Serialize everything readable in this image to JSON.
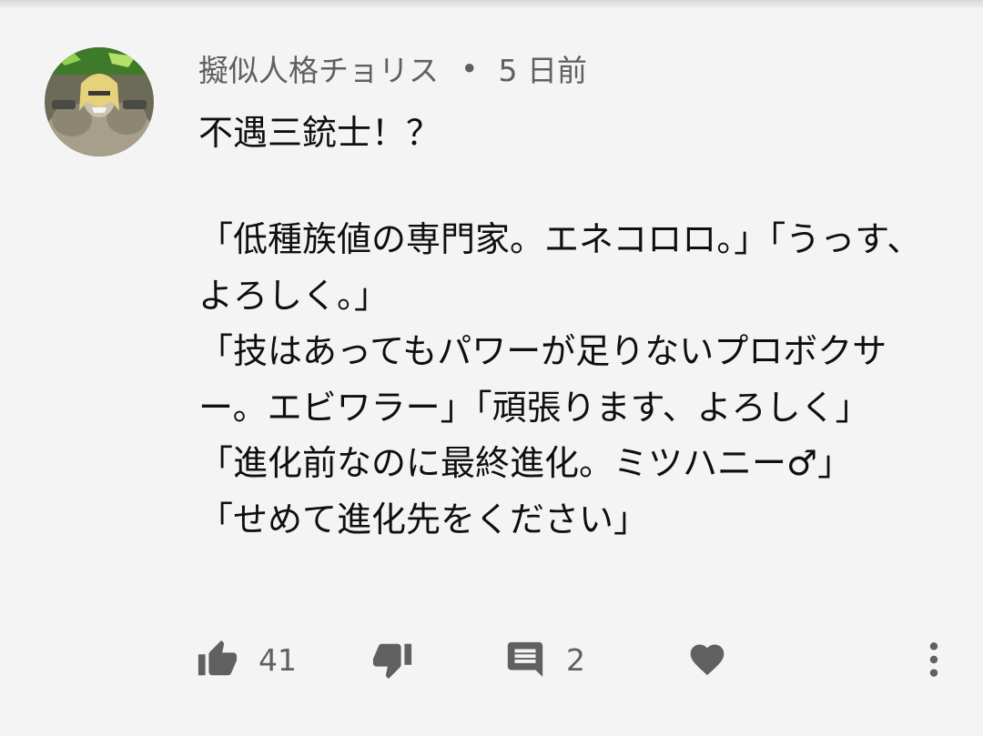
{
  "comment": {
    "author": "擬似人格チョリス",
    "separator": "•",
    "timestamp": "5 日前",
    "title": "不遇三銃士！？",
    "body": "「低種族値の専門家。エネコロロ。」「うっす、よろしく。」\n「技はあってもパワーが足りないプロボクサー。エビワラー」「頑張ります、よろしく」\n「進化前なのに最終進化。ミツハニー♂」\n「せめて進化先をください」"
  },
  "actions": {
    "like_icon": "thumbs-up-icon",
    "like_count": "41",
    "dislike_icon": "thumbs-down-icon",
    "reply_icon": "comment-icon",
    "reply_count": "2",
    "heart_icon": "heart-icon",
    "more_icon": "more-vertical-icon"
  },
  "colors": {
    "background": "#f4f4f4",
    "primary_text": "#0f0f0f",
    "secondary_text": "#606060"
  }
}
